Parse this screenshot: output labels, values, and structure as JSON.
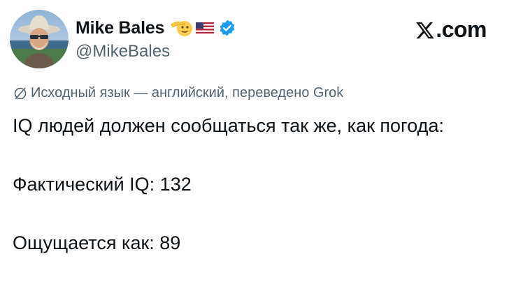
{
  "author": {
    "display_name": "Mike Bales",
    "handle": "@MikeBales",
    "emoji": [
      "saluting-face",
      "us-flag"
    ],
    "verified": true
  },
  "brand": {
    "label": ".com"
  },
  "translation_note": "Исходный язык — английский, переведено Grok",
  "tweet": {
    "lines": [
      "IQ людей должен сообщаться так же, как погода:",
      "Фактический IQ: 132",
      "Ощущается как: 89"
    ]
  },
  "colors": {
    "text": "#0f1419",
    "secondary": "#536471",
    "verified_blue": "#1d9bf0"
  }
}
